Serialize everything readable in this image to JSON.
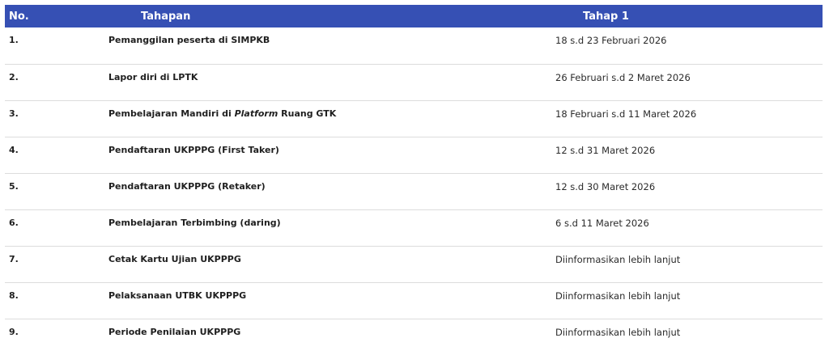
{
  "header": {
    "no": "No.",
    "tahapan": "Tahapan",
    "tahap1": "Tahap 1"
  },
  "rows": [
    {
      "no": "1.",
      "tahapan_pre": "Pemanggilan peserta di SIMPKB",
      "tahapan_em": "",
      "tahapan_post": "",
      "tahap1": "18 s.d 23 Februari 2026"
    },
    {
      "no": "2.",
      "tahapan_pre": "Lapor diri di LPTK",
      "tahapan_em": "",
      "tahapan_post": "",
      "tahap1": "26 Februari s.d 2 Maret 2026"
    },
    {
      "no": "3.",
      "tahapan_pre": "Pembelajaran Mandiri di ",
      "tahapan_em": "Platform",
      "tahapan_post": " Ruang GTK",
      "tahap1": "18 Februari s.d 11 Maret 2026"
    },
    {
      "no": "4.",
      "tahapan_pre": "Pendaftaran UKPPPG (First Taker)",
      "tahapan_em": "",
      "tahapan_post": "",
      "tahap1": "12 s.d 31 Maret 2026"
    },
    {
      "no": "5.",
      "tahapan_pre": "Pendaftaran UKPPPG (Retaker)",
      "tahapan_em": "",
      "tahapan_post": "",
      "tahap1": "12 s.d 30 Maret 2026"
    },
    {
      "no": "6.",
      "tahapan_pre": "Pembelajaran Terbimbing (daring)",
      "tahapan_em": "",
      "tahapan_post": "",
      "tahap1": "6 s.d 11 Maret 2026"
    },
    {
      "no": "7.",
      "tahapan_pre": "Cetak Kartu Ujian UKPPPG",
      "tahapan_em": "",
      "tahapan_post": "",
      "tahap1": "Diinformasikan lebih lanjut"
    },
    {
      "no": "8.",
      "tahapan_pre": "Pelaksanaan UTBK UKPPPG",
      "tahapan_em": "",
      "tahapan_post": "",
      "tahap1": "Diinformasikan lebih lanjut"
    },
    {
      "no": "9.",
      "tahapan_pre": "Periode Penilaian UKPPPG",
      "tahapan_em": "",
      "tahapan_post": "",
      "tahap1": "Diinformasikan lebih lanjut"
    }
  ],
  "colors": {
    "header_bg": "#3650b4",
    "header_text": "#ffffff",
    "row_divider": "#dcdcdc"
  }
}
